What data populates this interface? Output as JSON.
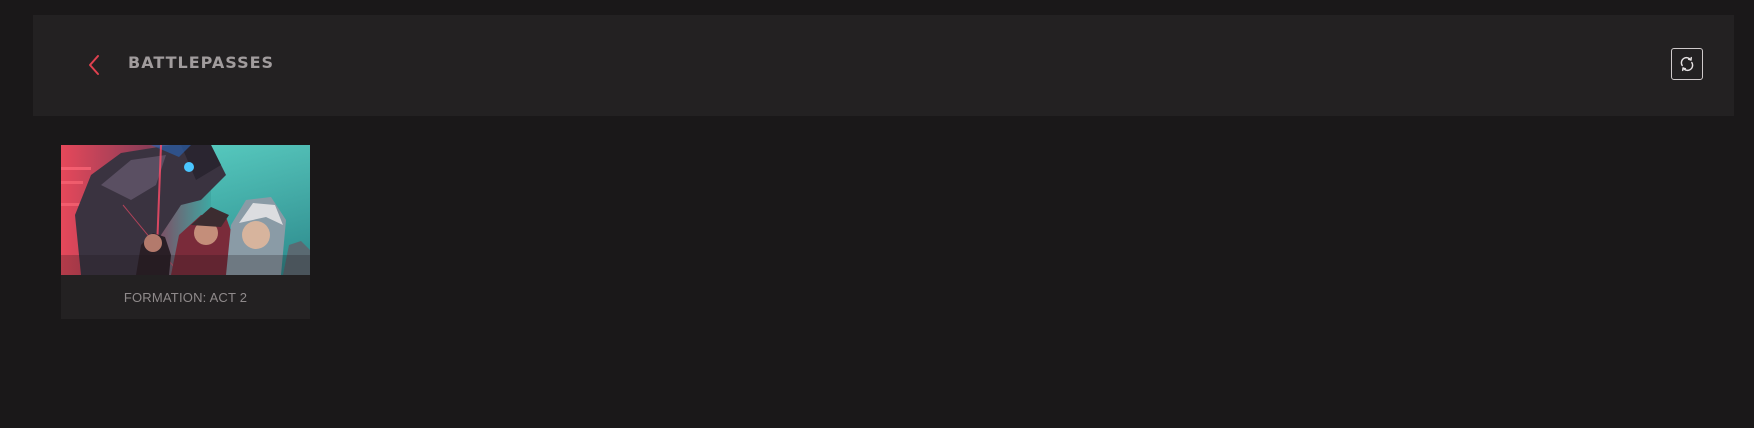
{
  "header": {
    "title": "BATTLEPASSES",
    "back_icon": "chevron-left-icon",
    "refresh_icon": "refresh-icon",
    "accent": "#e0414f"
  },
  "battlepasses": [
    {
      "name": "FORMATION: ACT 2",
      "image": "battlepass-artwork"
    }
  ]
}
